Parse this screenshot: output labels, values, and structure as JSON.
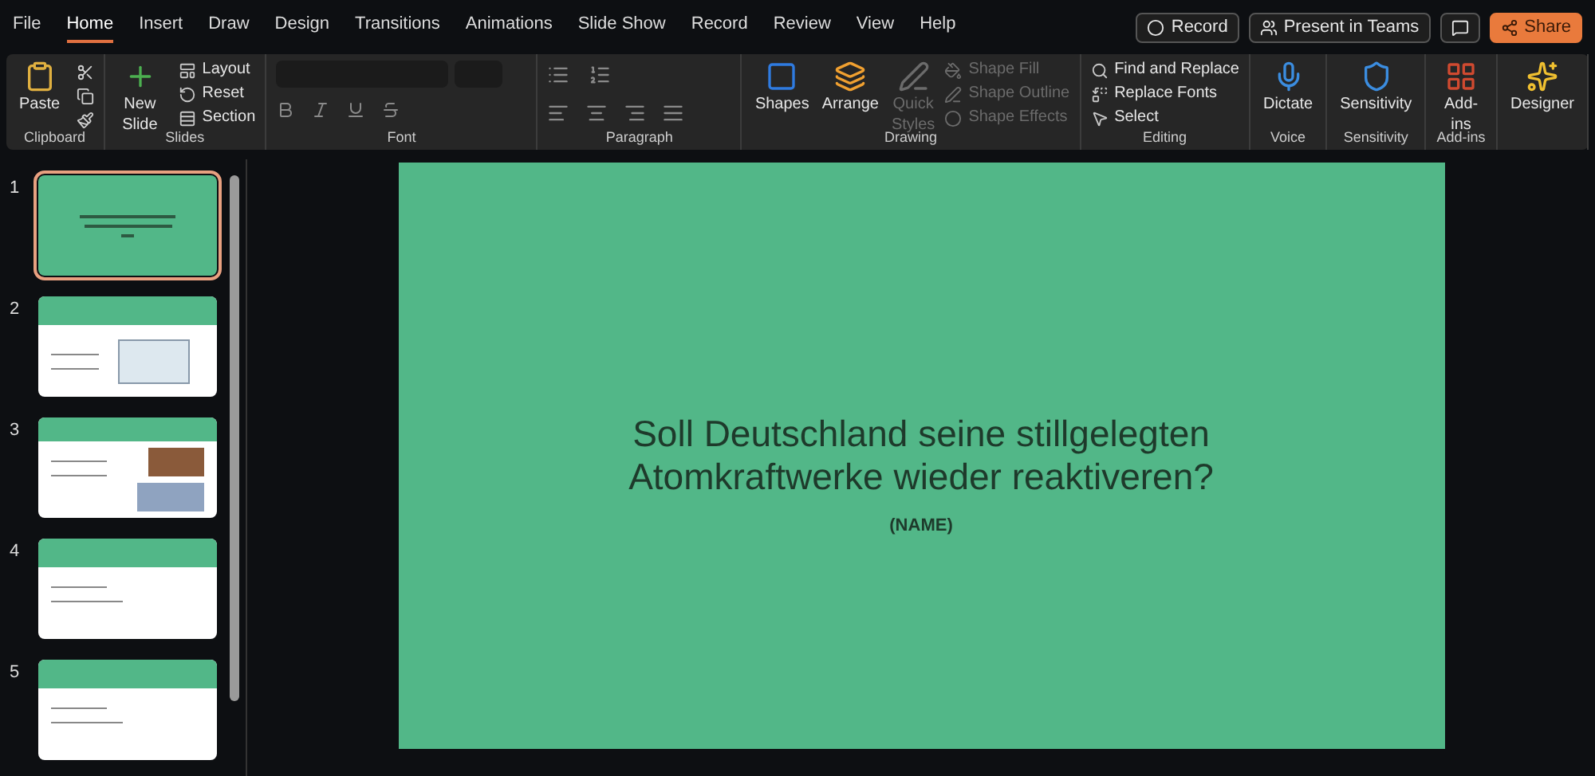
{
  "tabs": [
    {
      "label": "File",
      "selected": false
    },
    {
      "label": "Home",
      "selected": true
    },
    {
      "label": "Insert",
      "selected": false
    },
    {
      "label": "Draw",
      "selected": false
    },
    {
      "label": "Design",
      "selected": false
    },
    {
      "label": "Transitions",
      "selected": false
    },
    {
      "label": "Animations",
      "selected": false
    },
    {
      "label": "Slide Show",
      "selected": false
    },
    {
      "label": "Record",
      "selected": false
    },
    {
      "label": "Review",
      "selected": false
    },
    {
      "label": "View",
      "selected": false
    },
    {
      "label": "Help",
      "selected": false
    }
  ],
  "top_buttons": [
    {
      "kind": "record",
      "label": "Record"
    },
    {
      "kind": "teams",
      "label": "Present in Teams"
    },
    {
      "kind": "comment"
    },
    {
      "kind": "share",
      "label": "Share"
    }
  ],
  "ribbon_groups": [
    {
      "kind": "clipboard",
      "label": "Clipboard",
      "items": [
        {
          "label": "Paste",
          "disabled": false
        }
      ]
    },
    {
      "kind": "slides",
      "label": "Slides",
      "items": [
        {
          "label": "New Slide",
          "disabled": false
        },
        {
          "label": "Layout",
          "disabled": false
        },
        {
          "label": "Reset",
          "disabled": false
        },
        {
          "label": "Section",
          "disabled": false
        }
      ]
    },
    {
      "kind": "font",
      "label": "Font"
    },
    {
      "kind": "paragraph",
      "label": "Paragraph"
    },
    {
      "kind": "drawing",
      "label": "Drawing",
      "items": [
        {
          "label": "Shapes",
          "disabled": false
        },
        {
          "label": "Arrange",
          "disabled": false
        },
        {
          "label": "Quick Styles",
          "disabled": true
        },
        {
          "label": "Shape Fill",
          "disabled": true
        },
        {
          "label": "Shape Outline",
          "disabled": true
        },
        {
          "label": "Shape Effects",
          "disabled": true
        }
      ]
    },
    {
      "kind": "editing",
      "label": "Editing",
      "items": [
        {
          "label": "Find and Replace",
          "disabled": false
        },
        {
          "label": "Replace Fonts",
          "disabled": false
        },
        {
          "label": "Select",
          "disabled": false
        }
      ]
    },
    {
      "kind": "voice",
      "label": "Voice",
      "items": [
        {
          "label": "Dictate",
          "disabled": false
        }
      ]
    },
    {
      "kind": "sensitivity",
      "label": "Sensitivity",
      "items": [
        {
          "label": "Sensitivity",
          "disabled": false
        }
      ]
    },
    {
      "kind": "addins",
      "label": "Add-ins",
      "items": [
        {
          "label": "Add-ins",
          "disabled": false
        }
      ]
    },
    {
      "kind": "designer",
      "items": [
        {
          "label": "Designer",
          "disabled": false
        }
      ]
    }
  ],
  "thumbnails": [
    {
      "number": "1",
      "selected": true,
      "kind": "title"
    },
    {
      "number": "2",
      "selected": false,
      "kind": "diagram"
    },
    {
      "number": "3",
      "selected": false,
      "kind": "photos"
    },
    {
      "number": "4",
      "selected": false,
      "kind": "content"
    },
    {
      "number": "5",
      "selected": false,
      "kind": "content"
    }
  ],
  "slide": {
    "title": "Soll Deutschland seine stillgelegten Atomkraftwerke wieder reaktiveren?",
    "subtitle": "(NAME)"
  }
}
